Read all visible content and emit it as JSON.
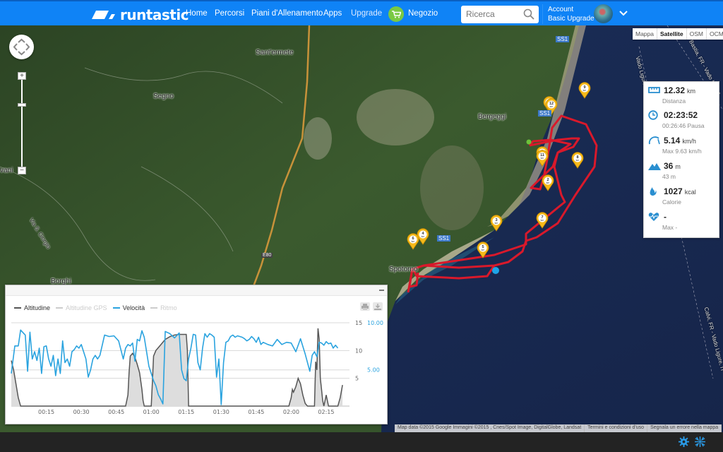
{
  "header": {
    "brand": "runtastic",
    "nav": [
      {
        "label": "Home"
      },
      {
        "label": "Percorsi"
      },
      {
        "label": "Piani d'Allenamento"
      },
      {
        "label": "Apps"
      },
      {
        "label": "Upgrade"
      },
      {
        "label": "Negozio"
      }
    ],
    "search": {
      "placeholder": "Ricerca",
      "value": ""
    },
    "account": {
      "line1": "Account",
      "line2": "Basic Upgrade"
    }
  },
  "map": {
    "type_buttons": [
      {
        "label": "Mappa",
        "active": false
      },
      {
        "label": "Satellite",
        "active": true
      },
      {
        "label": "OSM",
        "active": false
      },
      {
        "label": "OCM",
        "active": false
      }
    ],
    "zoom_in_label": "+",
    "zoom_out_label": "−",
    "place_labels": [
      "Sant'ermete",
      "Segno",
      "Bergeggi",
      "Spotorno",
      "Borghi",
      "vani",
      "Via S. Giorgio"
    ],
    "road_labels": [
      "SS1",
      "SS1",
      "SS1",
      "E80"
    ],
    "route_labels": [
      "Bastia, FR - Vado Ligure",
      "Calvi, FR - Vado Ligure, IT",
      "Vado Ligure"
    ],
    "km_markers": [
      "1 km",
      "2 km",
      "3 km",
      "4 km",
      "5 km",
      "6 km",
      "7 km",
      "8 km",
      "9 km",
      "10 km",
      "11 km",
      "12 km"
    ],
    "route_color": "#d9192b",
    "attribution": [
      "Map data ©2015 Google Immagini ©2015 , Cnes/Spot Image, DigitalGlobe, Landsat",
      "Termini e condizioni d'uso",
      "Segnala un errore nella mappa"
    ]
  },
  "stats": [
    {
      "icon": "ruler-icon",
      "value": "12.32",
      "unit": "km",
      "sub": "Distanza"
    },
    {
      "icon": "clock-icon",
      "value": "02:23:52",
      "unit": "",
      "sub": "00:26:46 Pausa"
    },
    {
      "icon": "speedometer-icon",
      "value": "5.14",
      "unit": "km/h",
      "sub": "Max 9.63 km/h"
    },
    {
      "icon": "mountain-icon",
      "value": "36",
      "unit": "m",
      "sub": "43 m"
    },
    {
      "icon": "flame-icon",
      "value": "1027",
      "unit": "kcal",
      "sub": "Calorie"
    },
    {
      "icon": "heart-rate-icon",
      "value": "-",
      "unit": "",
      "sub": "Max -"
    }
  ],
  "chart_data": {
    "type": "line",
    "title": "",
    "legend": [
      {
        "name": "Altitudine",
        "color": "#555555",
        "enabled": true
      },
      {
        "name": "Altitudine GPS",
        "color": "#cccccc",
        "enabled": false
      },
      {
        "name": "Velocità",
        "color": "#2aa3df",
        "enabled": true
      },
      {
        "name": "Ritmo",
        "color": "#cccccc",
        "enabled": false
      }
    ],
    "legend_position": "top-left",
    "x_ticks": [
      "00:15",
      "00:30",
      "00:45",
      "01:00",
      "01:15",
      "01:30",
      "01:45",
      "02:00",
      "02:15"
    ],
    "x_tick_minutes": [
      15,
      30,
      45,
      60,
      75,
      90,
      105,
      120,
      135
    ],
    "xlim_minutes": [
      0,
      145
    ],
    "y_left": {
      "ticks": [
        "15",
        "10",
        "5"
      ],
      "tick_values": [
        15,
        10,
        5
      ],
      "ylim": [
        0,
        15
      ]
    },
    "y_right": {
      "ticks": [
        "10.00",
        "5.00"
      ],
      "tick_values": [
        10,
        5
      ],
      "ylim": [
        0,
        11.5
      ],
      "color": "#2aa3df"
    },
    "grid": true,
    "series": [
      {
        "name": "Velocità",
        "axis": "right",
        "color": "#2aa3df",
        "x": [
          0,
          1.5,
          3,
          4,
          6,
          7,
          8,
          9,
          10,
          11,
          12,
          13,
          14,
          15,
          16,
          17,
          18,
          19,
          20,
          21,
          22,
          23,
          24,
          25,
          26,
          27,
          28,
          29,
          30,
          31,
          32,
          33,
          34,
          35,
          36,
          37,
          38,
          40,
          42,
          44,
          46,
          48,
          49,
          50,
          51,
          52,
          53,
          54,
          55,
          56,
          57,
          58,
          59,
          60,
          61,
          62,
          63,
          64,
          65,
          66,
          68,
          70,
          72,
          73,
          74,
          75,
          76,
          77,
          78,
          79,
          80,
          81,
          82,
          83,
          84,
          85,
          86,
          87,
          88,
          89,
          90,
          91,
          92,
          93,
          94,
          95,
          96,
          97,
          98,
          99,
          100,
          101,
          102,
          103,
          104,
          105,
          106,
          107,
          108,
          110,
          112,
          114,
          116,
          118,
          120,
          122,
          124,
          126,
          128,
          129,
          130,
          131,
          132,
          133,
          134,
          135,
          136,
          137,
          138,
          139,
          140,
          141,
          142
        ],
        "y": [
          4.5,
          8.3,
          8.3,
          10.5,
          9.8,
          4.8,
          10.2,
          6.5,
          7.5,
          6.3,
          8.0,
          4.5,
          8.2,
          8.3,
          6.5,
          5.5,
          7.0,
          4.2,
          6.5,
          4.5,
          9.0,
          6.0,
          6.5,
          5.5,
          7.5,
          7.8,
          8.3,
          8.0,
          8.5,
          7.5,
          6.5,
          4.0,
          5.0,
          6.5,
          7.0,
          6.5,
          7.0,
          9.8,
          9.6,
          9.7,
          9.0,
          6.5,
          8.0,
          8.5,
          8.3,
          8.7,
          6.2,
          9.2,
          9.0,
          10.4,
          9.5,
          7.5,
          5.5,
          4.5,
          3.5,
          2.8,
          1.6,
          1.0,
          0.3,
          10.3,
          10.0,
          9.4,
          10.1,
          5.0,
          3.8,
          3.5,
          6.5,
          8.0,
          9.9,
          9.8,
          6.0,
          5.0,
          8.0,
          10.0,
          9.5,
          10.0,
          9.8,
          9.5,
          4.0,
          6.5,
          0.2,
          6.0,
          8.8,
          9.0,
          9.6,
          9.8,
          9.5,
          9.7,
          9.6,
          9.5,
          9.3,
          9.0,
          9.2,
          9.6,
          9.3,
          8.8,
          9.5,
          8.5,
          8.8,
          8.5,
          8.3,
          9.2,
          8.5,
          8.8,
          8.7,
          7.5,
          9.3,
          7.2,
          4.8,
          7.0,
          7.5,
          6.8,
          8.8,
          8.7,
          8.4,
          8.9,
          8.6,
          8.7,
          8.0,
          8.4,
          8.0
        ]
      },
      {
        "name": "Altitudine",
        "axis": "left",
        "color": "#555555",
        "fill": "#dddddd",
        "x": [
          0,
          1,
          2,
          3,
          4,
          5,
          10,
          20,
          30,
          40,
          49,
          50,
          50.5,
          51,
          52,
          53,
          54,
          55,
          56,
          56.5,
          57,
          58,
          60,
          60.5,
          61,
          62,
          64,
          66,
          68,
          70,
          72,
          74,
          75,
          75.5,
          76,
          80,
          90,
          100,
          110,
          119,
          120,
          120.5,
          121,
          122,
          123,
          124,
          125,
          126,
          127,
          128,
          129,
          130,
          130.5,
          131,
          131.5,
          132,
          132.5,
          133,
          133.5,
          134,
          135,
          136,
          137,
          138,
          140,
          141,
          142
        ],
        "y": [
          8.2,
          6.5,
          4.0,
          1.5,
          0,
          0,
          0,
          0,
          0,
          0,
          0,
          2.0,
          6.0,
          9.0,
          9.5,
          8.8,
          7.5,
          6.0,
          3.0,
          1.0,
          0,
          0,
          0,
          4.5,
          9.0,
          10.0,
          11.0,
          12.0,
          12.5,
          12.8,
          12.9,
          12.9,
          12.9,
          10.0,
          0,
          0,
          0,
          0,
          0,
          0,
          1.5,
          3.0,
          2.5,
          3.5,
          5.0,
          4.0,
          2.0,
          0.5,
          0,
          0,
          0,
          0,
          8.0,
          6.5,
          14.0,
          12.0,
          5.0,
          3.0,
          1.0,
          0,
          2.0,
          0,
          0,
          0,
          0,
          1.5,
          3.8
        ]
      }
    ]
  },
  "bottombar": {
    "icons": [
      "gear-icon",
      "collapse-icon"
    ]
  }
}
